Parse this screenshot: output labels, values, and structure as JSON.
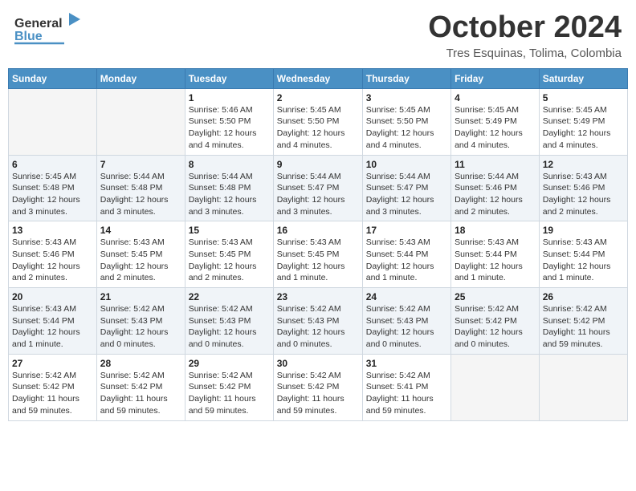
{
  "header": {
    "logo_line1": "General",
    "logo_line2": "Blue",
    "month": "October 2024",
    "location": "Tres Esquinas, Tolima, Colombia"
  },
  "days_of_week": [
    "Sunday",
    "Monday",
    "Tuesday",
    "Wednesday",
    "Thursday",
    "Friday",
    "Saturday"
  ],
  "weeks": [
    [
      {
        "day": "",
        "info": ""
      },
      {
        "day": "",
        "info": ""
      },
      {
        "day": "1",
        "info": "Sunrise: 5:46 AM\nSunset: 5:50 PM\nDaylight: 12 hours\nand 4 minutes."
      },
      {
        "day": "2",
        "info": "Sunrise: 5:45 AM\nSunset: 5:50 PM\nDaylight: 12 hours\nand 4 minutes."
      },
      {
        "day": "3",
        "info": "Sunrise: 5:45 AM\nSunset: 5:50 PM\nDaylight: 12 hours\nand 4 minutes."
      },
      {
        "day": "4",
        "info": "Sunrise: 5:45 AM\nSunset: 5:49 PM\nDaylight: 12 hours\nand 4 minutes."
      },
      {
        "day": "5",
        "info": "Sunrise: 5:45 AM\nSunset: 5:49 PM\nDaylight: 12 hours\nand 4 minutes."
      }
    ],
    [
      {
        "day": "6",
        "info": "Sunrise: 5:45 AM\nSunset: 5:48 PM\nDaylight: 12 hours\nand 3 minutes."
      },
      {
        "day": "7",
        "info": "Sunrise: 5:44 AM\nSunset: 5:48 PM\nDaylight: 12 hours\nand 3 minutes."
      },
      {
        "day": "8",
        "info": "Sunrise: 5:44 AM\nSunset: 5:48 PM\nDaylight: 12 hours\nand 3 minutes."
      },
      {
        "day": "9",
        "info": "Sunrise: 5:44 AM\nSunset: 5:47 PM\nDaylight: 12 hours\nand 3 minutes."
      },
      {
        "day": "10",
        "info": "Sunrise: 5:44 AM\nSunset: 5:47 PM\nDaylight: 12 hours\nand 3 minutes."
      },
      {
        "day": "11",
        "info": "Sunrise: 5:44 AM\nSunset: 5:46 PM\nDaylight: 12 hours\nand 2 minutes."
      },
      {
        "day": "12",
        "info": "Sunrise: 5:43 AM\nSunset: 5:46 PM\nDaylight: 12 hours\nand 2 minutes."
      }
    ],
    [
      {
        "day": "13",
        "info": "Sunrise: 5:43 AM\nSunset: 5:46 PM\nDaylight: 12 hours\nand 2 minutes."
      },
      {
        "day": "14",
        "info": "Sunrise: 5:43 AM\nSunset: 5:45 PM\nDaylight: 12 hours\nand 2 minutes."
      },
      {
        "day": "15",
        "info": "Sunrise: 5:43 AM\nSunset: 5:45 PM\nDaylight: 12 hours\nand 2 minutes."
      },
      {
        "day": "16",
        "info": "Sunrise: 5:43 AM\nSunset: 5:45 PM\nDaylight: 12 hours\nand 1 minute."
      },
      {
        "day": "17",
        "info": "Sunrise: 5:43 AM\nSunset: 5:44 PM\nDaylight: 12 hours\nand 1 minute."
      },
      {
        "day": "18",
        "info": "Sunrise: 5:43 AM\nSunset: 5:44 PM\nDaylight: 12 hours\nand 1 minute."
      },
      {
        "day": "19",
        "info": "Sunrise: 5:43 AM\nSunset: 5:44 PM\nDaylight: 12 hours\nand 1 minute."
      }
    ],
    [
      {
        "day": "20",
        "info": "Sunrise: 5:43 AM\nSunset: 5:44 PM\nDaylight: 12 hours\nand 1 minute."
      },
      {
        "day": "21",
        "info": "Sunrise: 5:42 AM\nSunset: 5:43 PM\nDaylight: 12 hours\nand 0 minutes."
      },
      {
        "day": "22",
        "info": "Sunrise: 5:42 AM\nSunset: 5:43 PM\nDaylight: 12 hours\nand 0 minutes."
      },
      {
        "day": "23",
        "info": "Sunrise: 5:42 AM\nSunset: 5:43 PM\nDaylight: 12 hours\nand 0 minutes."
      },
      {
        "day": "24",
        "info": "Sunrise: 5:42 AM\nSunset: 5:43 PM\nDaylight: 12 hours\nand 0 minutes."
      },
      {
        "day": "25",
        "info": "Sunrise: 5:42 AM\nSunset: 5:42 PM\nDaylight: 12 hours\nand 0 minutes."
      },
      {
        "day": "26",
        "info": "Sunrise: 5:42 AM\nSunset: 5:42 PM\nDaylight: 11 hours\nand 59 minutes."
      }
    ],
    [
      {
        "day": "27",
        "info": "Sunrise: 5:42 AM\nSunset: 5:42 PM\nDaylight: 11 hours\nand 59 minutes."
      },
      {
        "day": "28",
        "info": "Sunrise: 5:42 AM\nSunset: 5:42 PM\nDaylight: 11 hours\nand 59 minutes."
      },
      {
        "day": "29",
        "info": "Sunrise: 5:42 AM\nSunset: 5:42 PM\nDaylight: 11 hours\nand 59 minutes."
      },
      {
        "day": "30",
        "info": "Sunrise: 5:42 AM\nSunset: 5:42 PM\nDaylight: 11 hours\nand 59 minutes."
      },
      {
        "day": "31",
        "info": "Sunrise: 5:42 AM\nSunset: 5:41 PM\nDaylight: 11 hours\nand 59 minutes."
      },
      {
        "day": "",
        "info": ""
      },
      {
        "day": "",
        "info": ""
      }
    ]
  ]
}
